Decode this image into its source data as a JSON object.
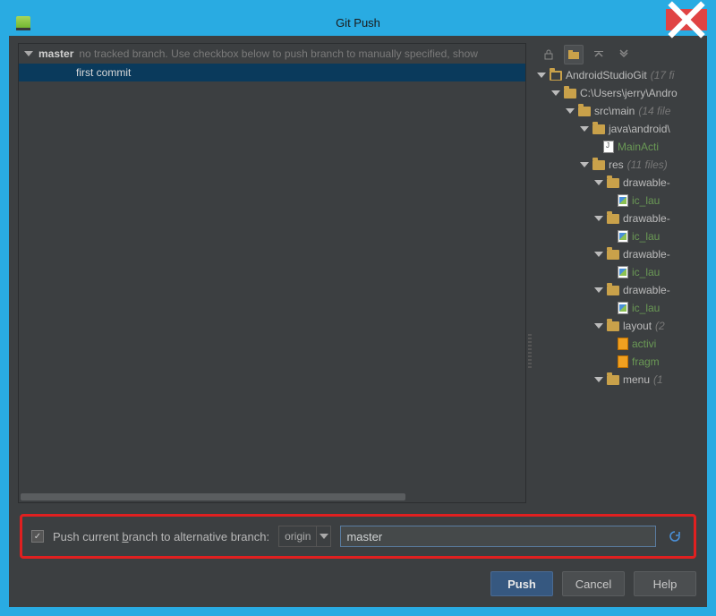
{
  "window": {
    "title": "Git Push"
  },
  "branch": {
    "name": "master",
    "hint": "no tracked branch. Use checkbox below to push branch to manually specified, show"
  },
  "commits": [
    {
      "message": "first commit"
    }
  ],
  "toolbar_icons": [
    "lock-icon",
    "group-by-dir-icon",
    "expand-all-icon",
    "collapse-all-icon"
  ],
  "tree": {
    "root": {
      "label": "AndroidStudioGit",
      "count": "(17 fi"
    },
    "nodes": [
      {
        "indent": 1,
        "type": "folder",
        "label": "C:\\Users\\jerry\\Andro",
        "count": ""
      },
      {
        "indent": 2,
        "type": "folder",
        "label": "src\\main",
        "count": "(14 file"
      },
      {
        "indent": 3,
        "type": "folder",
        "label": "java\\android\\",
        "count": ""
      },
      {
        "indent": 4,
        "type": "java",
        "label": "MainActi",
        "green": true
      },
      {
        "indent": 3,
        "type": "folder",
        "label": "res",
        "count": "(11 files)"
      },
      {
        "indent": 4,
        "type": "folder",
        "label": "drawable-",
        "count": ""
      },
      {
        "indent": 5,
        "type": "img",
        "label": "ic_lau",
        "green": true
      },
      {
        "indent": 4,
        "type": "folder",
        "label": "drawable-",
        "count": ""
      },
      {
        "indent": 5,
        "type": "img",
        "label": "ic_lau",
        "green": true
      },
      {
        "indent": 4,
        "type": "folder",
        "label": "drawable-",
        "count": ""
      },
      {
        "indent": 5,
        "type": "img",
        "label": "ic_lau",
        "green": true
      },
      {
        "indent": 4,
        "type": "folder",
        "label": "drawable-",
        "count": ""
      },
      {
        "indent": 5,
        "type": "img",
        "label": "ic_lau",
        "green": true
      },
      {
        "indent": 4,
        "type": "folder",
        "label": "layout",
        "count": "(2"
      },
      {
        "indent": 5,
        "type": "xml",
        "label": "activi",
        "green": true
      },
      {
        "indent": 5,
        "type": "xml",
        "label": "fragm",
        "green": true
      },
      {
        "indent": 4,
        "type": "folder",
        "label": "menu",
        "count": "(1"
      }
    ]
  },
  "push_alt": {
    "checkbox_label_pre": "Push current ",
    "checkbox_label_ul": "b",
    "checkbox_label_post": "ranch to alternative branch:",
    "remote": "origin",
    "branch_value": "master",
    "checked": true
  },
  "buttons": {
    "push": "Push",
    "cancel": "Cancel",
    "help": "Help"
  }
}
